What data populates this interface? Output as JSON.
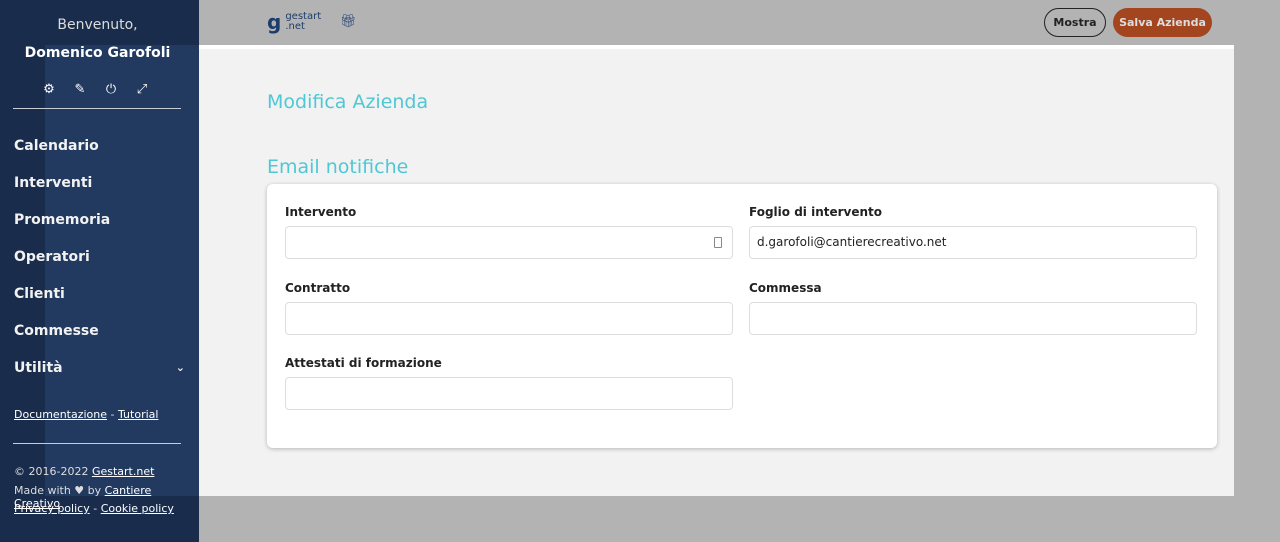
{
  "sidebar": {
    "welcome": "Benvenuto,",
    "user": "Domenico Garofoli",
    "nav": [
      {
        "label": "Calendario"
      },
      {
        "label": "Interventi"
      },
      {
        "label": "Promemoria"
      },
      {
        "label": "Operatori"
      },
      {
        "label": "Clienti"
      },
      {
        "label": "Commesse"
      },
      {
        "label": "Utilità"
      }
    ],
    "docs": "Documentazione",
    "sep": " - ",
    "tutorial": "Tutorial",
    "copyright": "© 2016-2022 ",
    "gestart": "Gestart.net",
    "made": "Made with ♥ by ",
    "cc": "Cantiere Creativo",
    "privacy": "Privacy policy",
    "cookie": "Cookie policy"
  },
  "topbar": {
    "logo_top": "gestart",
    "logo_bottom": ".net",
    "mostra": "Mostra",
    "salva": "Salva Azienda"
  },
  "main": {
    "title": "Modifica Azienda",
    "section": "Email notifiche",
    "fields": [
      {
        "label": "Intervento",
        "value": ""
      },
      {
        "label": "Foglio di intervento",
        "value": "d.garofoli@cantierecreativo.net"
      },
      {
        "label": "Contratto",
        "value": ""
      },
      {
        "label": "Commessa",
        "value": ""
      },
      {
        "label": "Attestati di formazione",
        "value": ""
      }
    ]
  }
}
